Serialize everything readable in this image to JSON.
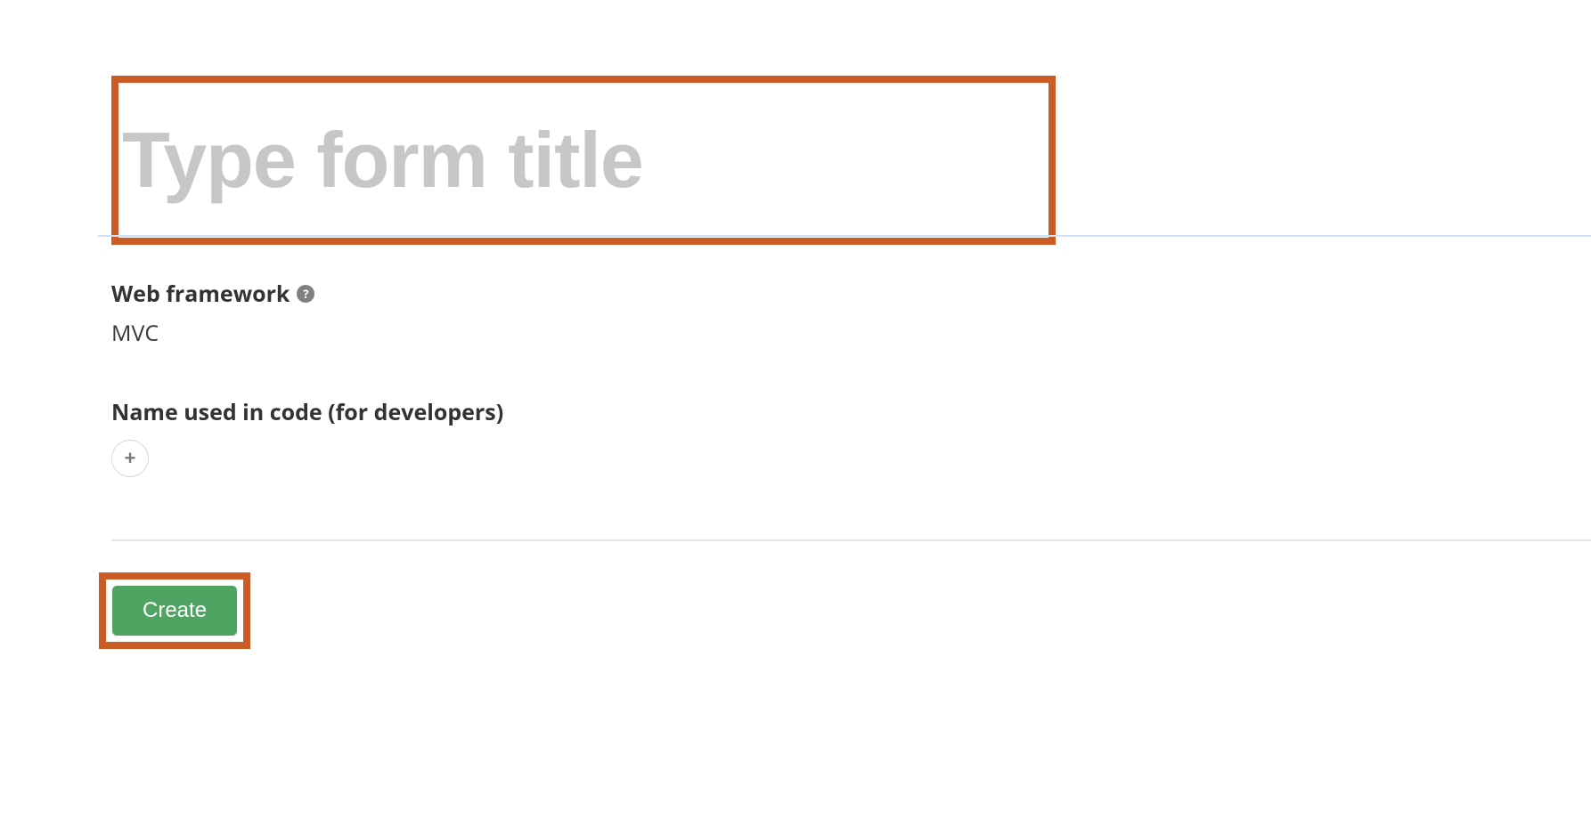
{
  "form": {
    "title_placeholder": "Type form title",
    "title_value": ""
  },
  "fields": {
    "web_framework": {
      "label": "Web framework",
      "value": "MVC",
      "help_icon": "?"
    },
    "name_in_code": {
      "label": "Name used in code (for developers)",
      "plus_icon": "+"
    }
  },
  "actions": {
    "create_label": "Create"
  },
  "highlight_color": "#cc5c26",
  "accent_color": "#4fa461"
}
